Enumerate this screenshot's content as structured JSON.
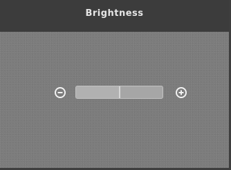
{
  "osd": {
    "title": "Brightness"
  },
  "slider": {
    "value_fraction": 0.5,
    "decrease_icon": "minus-circle-icon",
    "increase_icon": "plus-circle-icon"
  },
  "colors": {
    "panel": "#7c7c7c",
    "title_bar": "#3c3c3c",
    "title_text": "#e6e6e6",
    "icon": "#f2f2f2",
    "track": "#a6a6a6"
  }
}
